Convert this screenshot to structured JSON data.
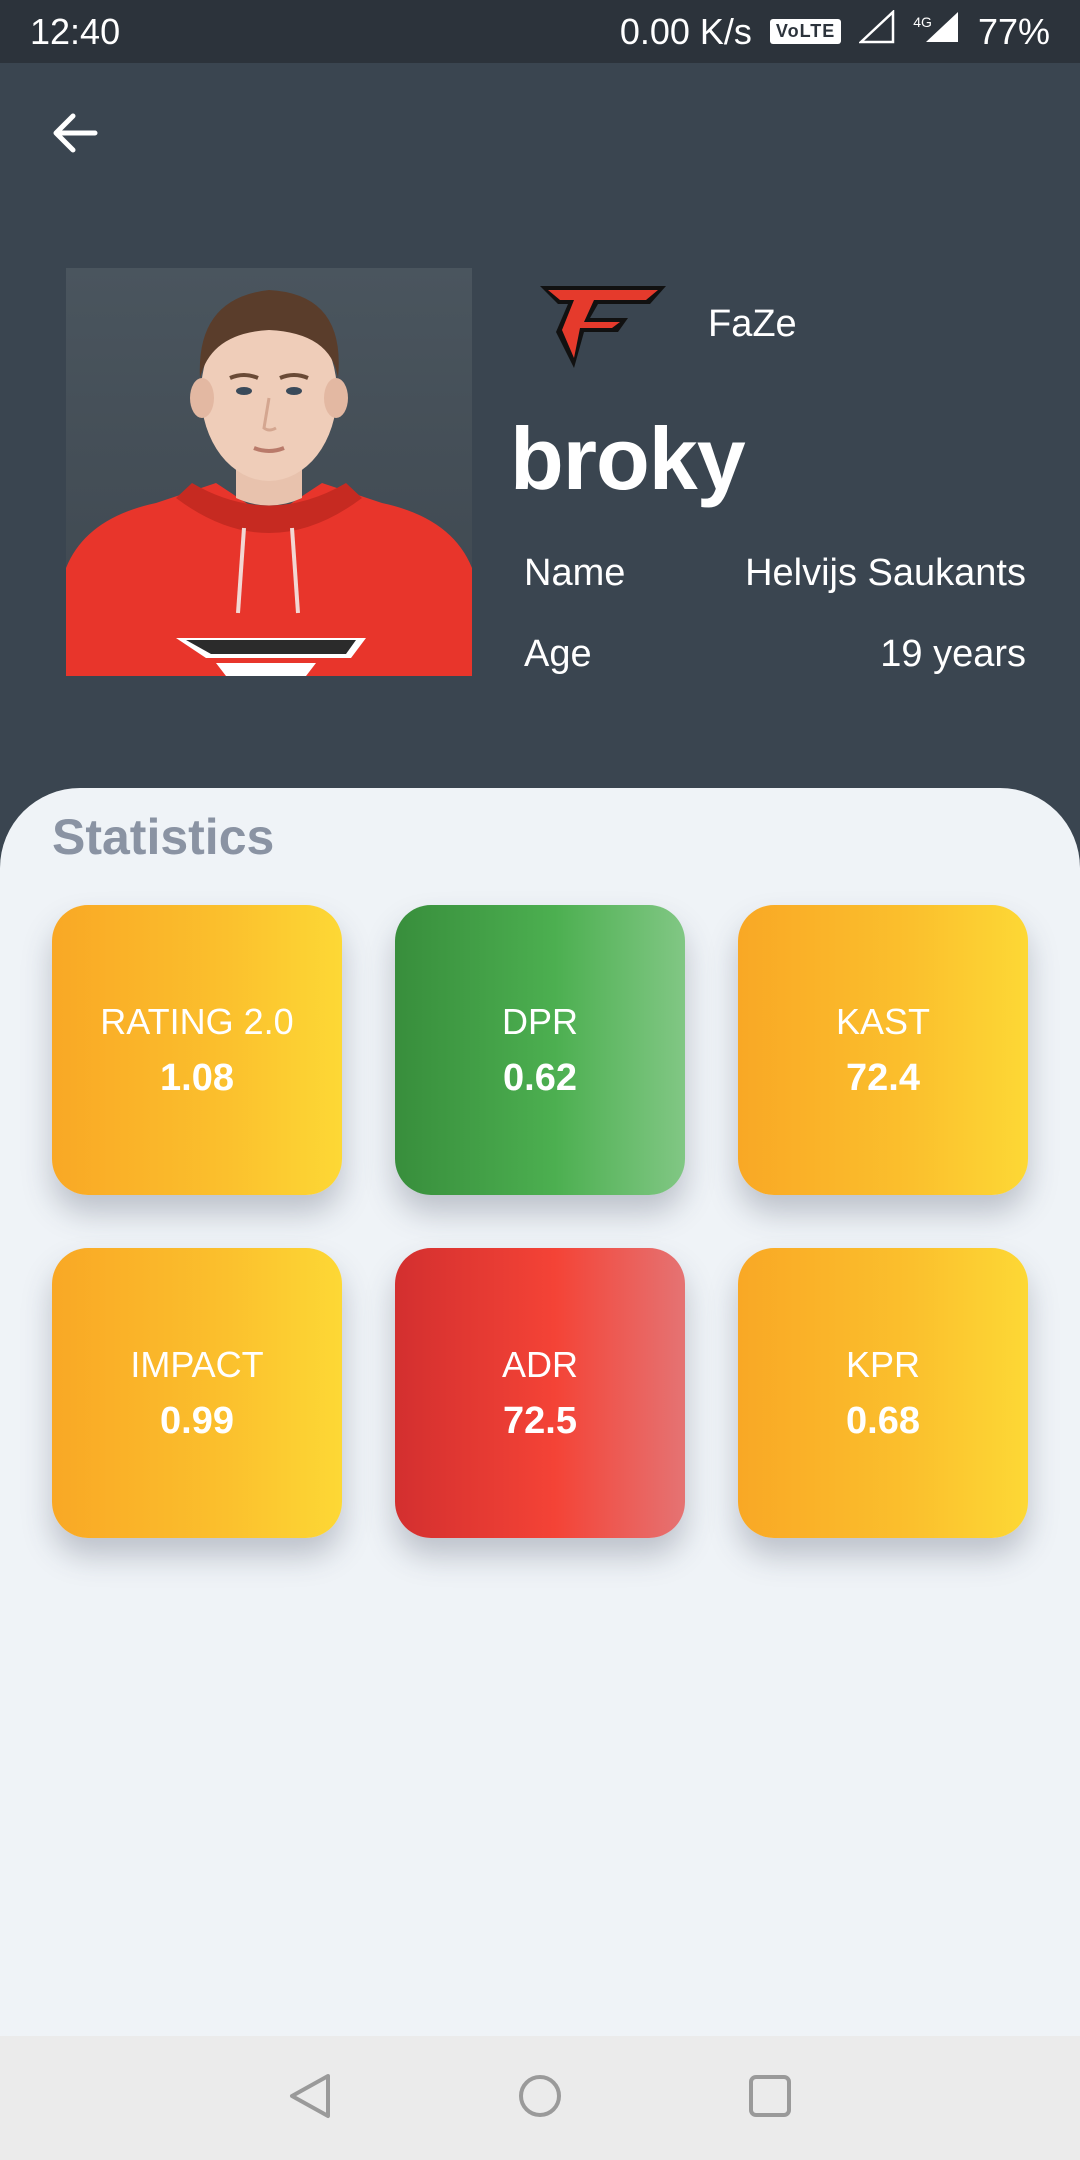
{
  "status_bar": {
    "time": "12:40",
    "network_speed": "0.00 K/s",
    "volte": "VoLTE",
    "network_type": "4G",
    "battery": "77%"
  },
  "header": {
    "back_icon": "arrow-left-icon"
  },
  "player": {
    "team": "FaZe",
    "nickname": "broky",
    "name_label": "Name",
    "name_value": "Helvijs Saukants",
    "age_label": "Age",
    "age_value": "19 years"
  },
  "stats": {
    "title": "Statistics",
    "items": [
      {
        "label": "RATING 2.0",
        "value": "1.08"
      },
      {
        "label": "DPR",
        "value": "0.62"
      },
      {
        "label": "KAST",
        "value": "72.4"
      },
      {
        "label": "IMPACT",
        "value": "0.99"
      },
      {
        "label": "ADR",
        "value": "72.5"
      },
      {
        "label": "KPR",
        "value": "0.68"
      }
    ]
  },
  "colors": {
    "header_bg": "#3a4550",
    "status_bar_bg": "#2c333b",
    "sheet_bg": "#eff3f7",
    "stats_title": "#8a93a3",
    "good": "#4caf50",
    "average": "#fbc02d",
    "bad": "#f44336",
    "team_red": "#e53a2c"
  },
  "nav_bar": {
    "back_icon": "triangle-back-icon",
    "home_icon": "circle-home-icon",
    "recents_icon": "square-recents-icon"
  }
}
